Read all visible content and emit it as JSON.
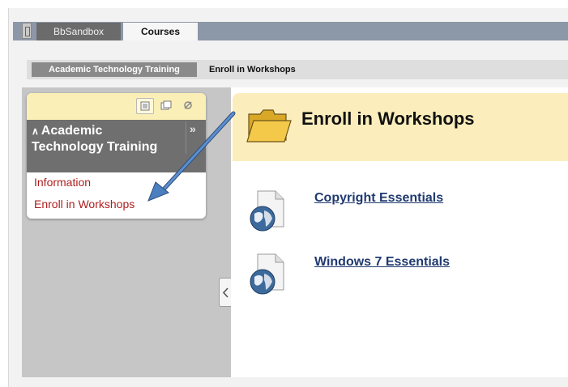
{
  "tabs": [
    {
      "label": "BbSandbox"
    },
    {
      "label": "Courses"
    }
  ],
  "breadcrumb": {
    "course": "Academic Technology Training",
    "current": "Enroll in Workshops"
  },
  "course_menu": {
    "title": "Academic Technology Training",
    "items": [
      {
        "label": "Information"
      },
      {
        "label": "Enroll in Workshops"
      }
    ]
  },
  "content": {
    "title": "Enroll in Workshops",
    "items": [
      {
        "label": "Copyright Essentials"
      },
      {
        "label": "Windows 7 Essentials"
      }
    ]
  },
  "colors": {
    "tab_bar": "#8c97a8",
    "menu_header": "#6f6f6f",
    "menu_link": "#b01e1e",
    "content_header": "#fcedbc",
    "content_link": "#203a70",
    "annotation_arrow": "#4a7fc0"
  },
  "icons": {
    "menu_toolbar": [
      "list-view-icon",
      "folder-view-icon",
      "refresh-icon"
    ],
    "content_header": "folder-icon",
    "content_items": "web-link-icon",
    "collapse": "chevron-left-icon",
    "annotation": "pointer-arrow-icon"
  }
}
